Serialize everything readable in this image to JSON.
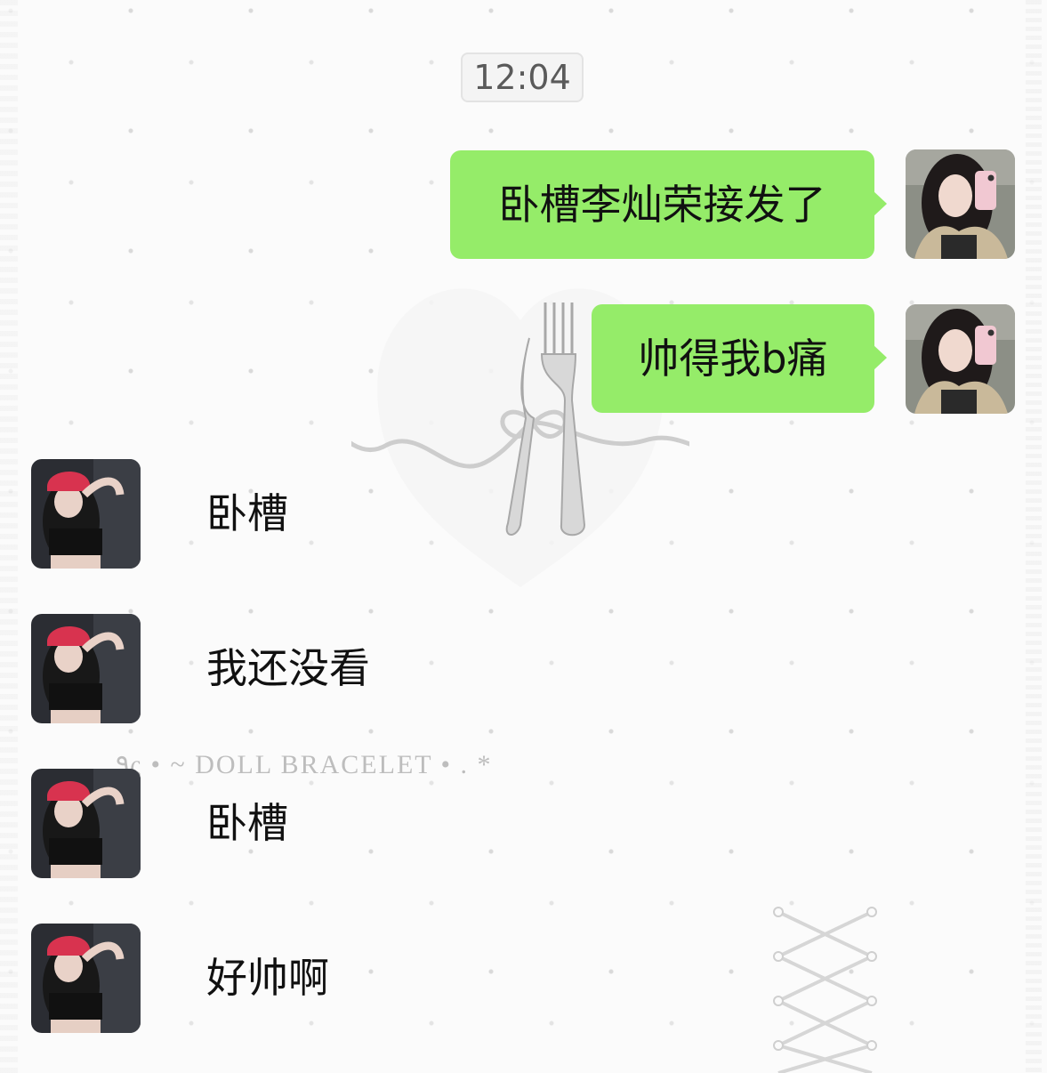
{
  "timestamp": "12:04",
  "background": {
    "decor_text": "۹ς • ~ DOLL BRACELET • . *",
    "bubble_color": "#95ec69"
  },
  "messages": [
    {
      "side": "sent",
      "text": "卧槽李灿荣接发了",
      "avatar": "self-avatar-photo"
    },
    {
      "side": "sent",
      "text": "帅得我b痛",
      "avatar": "self-avatar-photo"
    },
    {
      "side": "received",
      "text": "卧槽",
      "avatar": "friend-avatar-photo"
    },
    {
      "side": "received",
      "text": "我还没看",
      "avatar": "friend-avatar-photo"
    },
    {
      "side": "received",
      "text": "卧槽",
      "avatar": "friend-avatar-photo"
    },
    {
      "side": "received",
      "text": "好帅啊",
      "avatar": "friend-avatar-photo"
    }
  ]
}
